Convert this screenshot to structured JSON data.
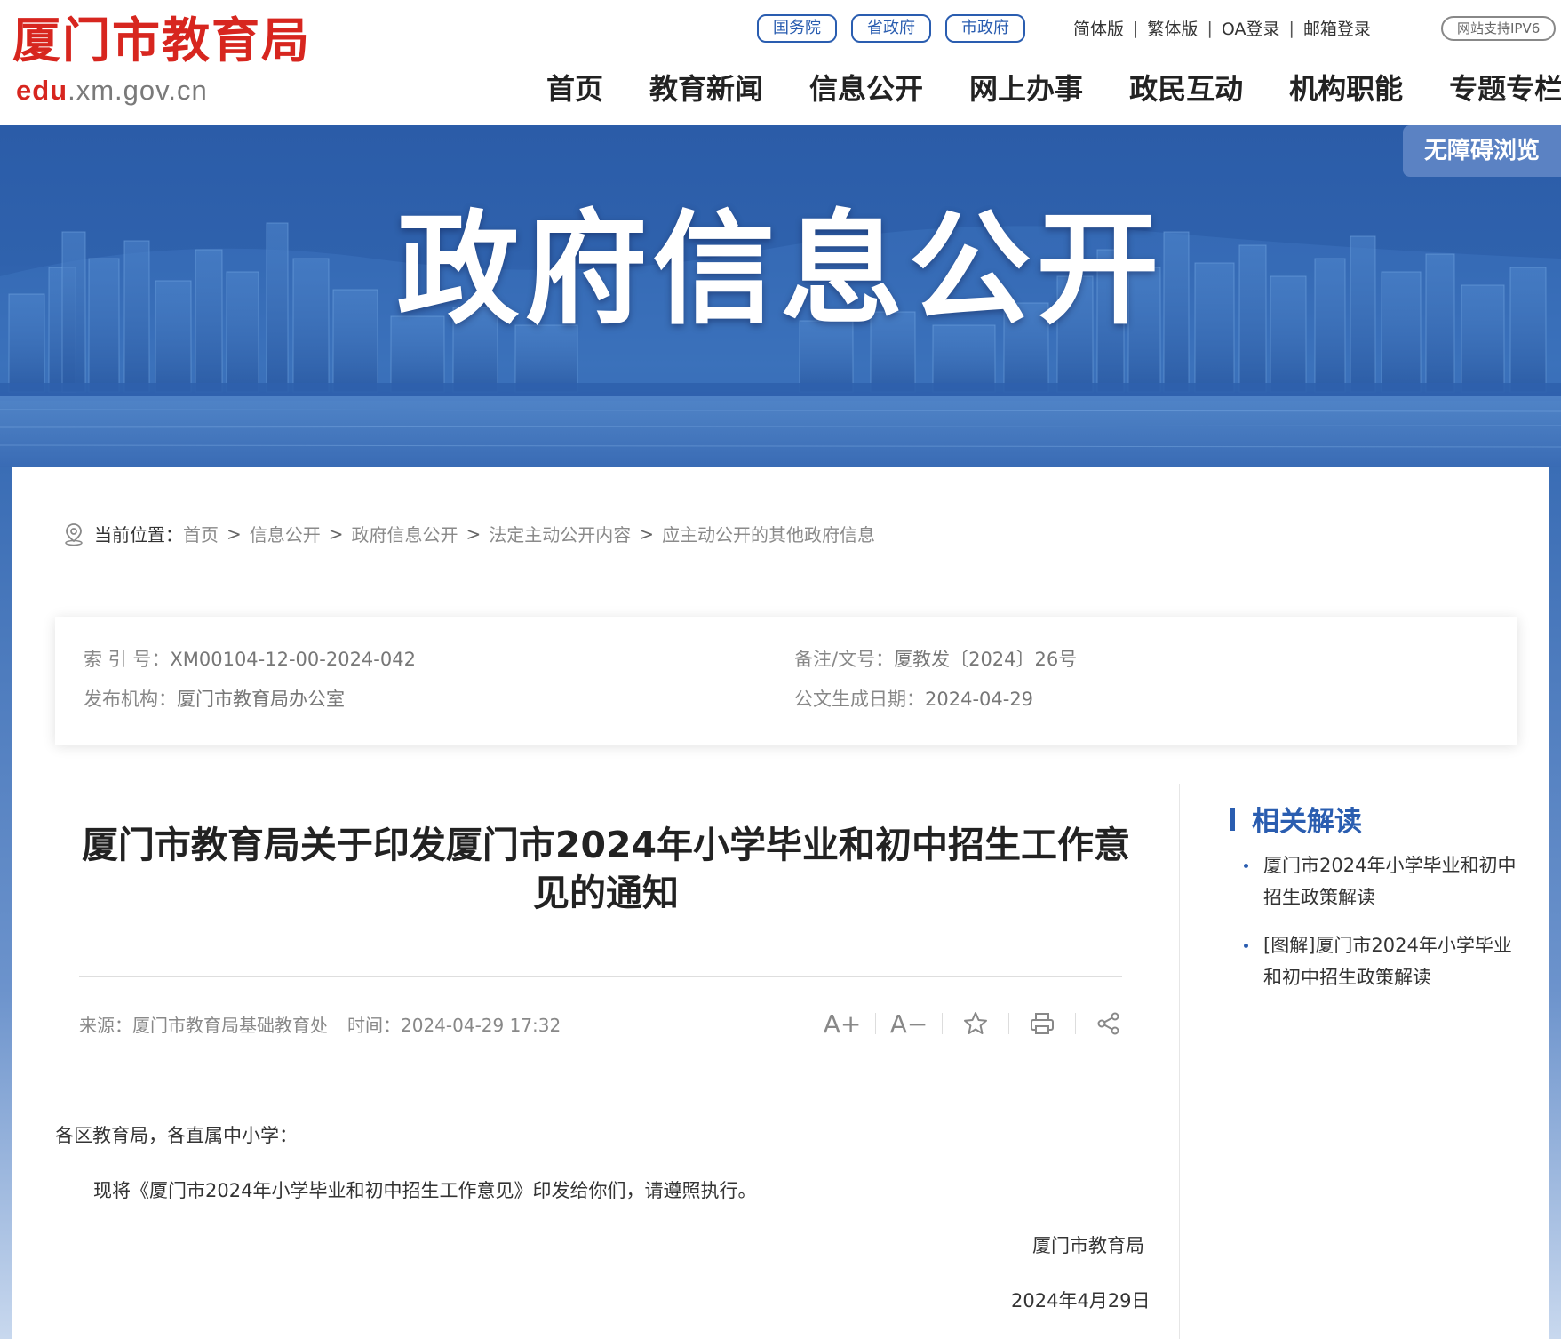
{
  "header": {
    "logo_cn": "厦门市教育局",
    "logo_en_prefix": "edu",
    "logo_en_rest": ".xm.gov.cn",
    "gov_links": [
      "国务院",
      "省政府",
      "市政府"
    ],
    "util_links": [
      "简体版",
      "繁体版",
      "OA登录",
      "邮箱登录"
    ],
    "util_sep": "|",
    "ipv6": "网站支持IPV6",
    "nav": [
      "首页",
      "教育新闻",
      "信息公开",
      "网上办事",
      "政民互动",
      "机构职能",
      "专题专栏"
    ]
  },
  "banner": {
    "title": "政府信息公开",
    "accessibility": "无障碍浏览"
  },
  "breadcrumb": {
    "label": "当前位置：",
    "items": [
      "首页",
      "信息公开",
      "政府信息公开",
      "法定主动公开内容",
      "应主动公开的其他政府信息"
    ],
    "sep": ">"
  },
  "meta": {
    "index_key": "索 引 号：",
    "index_val": "XM00104-12-00-2024-042",
    "doc_key": "备注/文号：",
    "doc_val": "厦教发〔2024〕26号",
    "org_key": "发布机构：",
    "org_val": "厦门市教育局办公室",
    "date_key": "公文生成日期：",
    "date_val": "2024-04-29"
  },
  "article": {
    "title_line1": "厦门市教育局关于印发厦门市2024年小学毕业和初中招生工作意",
    "title_line2": "见的通知",
    "source_key": "来源：",
    "source_val": "厦门市教育局基础教育处",
    "time_key": "时间：",
    "time_val": "2024-04-29 17:32",
    "tools": {
      "font_up": "A+",
      "font_down": "A−"
    },
    "salutation": "各区教育局，各直属中小学：",
    "paragraph": "现将《厦门市2024年小学毕业和初中招生工作意见》印发给你们，请遵照执行。",
    "signature": "厦门市教育局",
    "date": "2024年4月29日"
  },
  "related": {
    "heading": "相关解读",
    "items": [
      {
        "line1": "厦门市2024年小学毕业和初中",
        "line2": "招生政策解读"
      },
      {
        "line1": "[图解]厦门市2024年小学毕业",
        "line2": "和初中招生政策解读"
      }
    ]
  },
  "colors": {
    "brand_red": "#d7261f",
    "brand_blue": "#2a5db0",
    "banner_blue": "#2f62ad"
  }
}
